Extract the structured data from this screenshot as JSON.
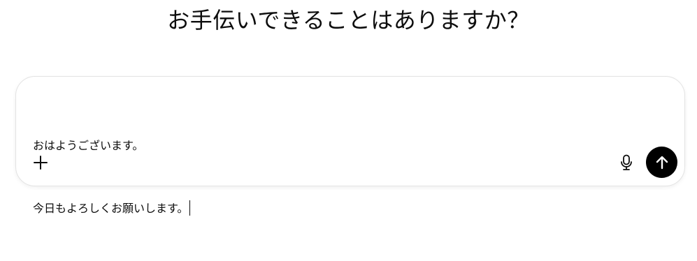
{
  "page": {
    "heading": "お手伝いできることはありますか？"
  },
  "composer": {
    "lines": [
      "おはようございます。",
      "今日もよろしくお願いします。"
    ]
  },
  "icons": {
    "add": "plus-icon",
    "voice": "microphone-icon",
    "send": "arrow-up-icon"
  },
  "colors": {
    "send_button_bg": "#000000",
    "send_icon": "#ffffff",
    "text": "#0d0d0d",
    "composer_border": "#e3e3e3"
  }
}
